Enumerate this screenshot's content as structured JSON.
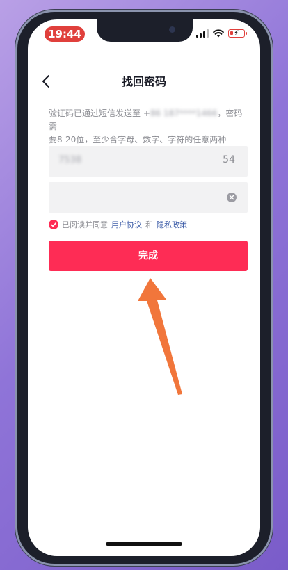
{
  "status_bar": {
    "time": "19:44"
  },
  "header": {
    "title": "找回密码"
  },
  "description": {
    "line1_prefix": "验证码已通过短信发送至 +",
    "masked_phone": "86 187****1466",
    "line1_suffix": "，密码需",
    "line2": "要8-20位，至少含字母、数字、字符的任意两种"
  },
  "code_field": {
    "value": "7538",
    "countdown": "54"
  },
  "password_field": {
    "value": ""
  },
  "agreement": {
    "prefix": "已阅读并同意",
    "user_agreement": "用户协议",
    "conjunction": "和",
    "privacy_policy": "隐私政策"
  },
  "done_button": {
    "label": "完成"
  },
  "colors": {
    "accent": "#fe2c55",
    "link": "#3d5da8",
    "annotation_arrow": "#f06a2a"
  }
}
